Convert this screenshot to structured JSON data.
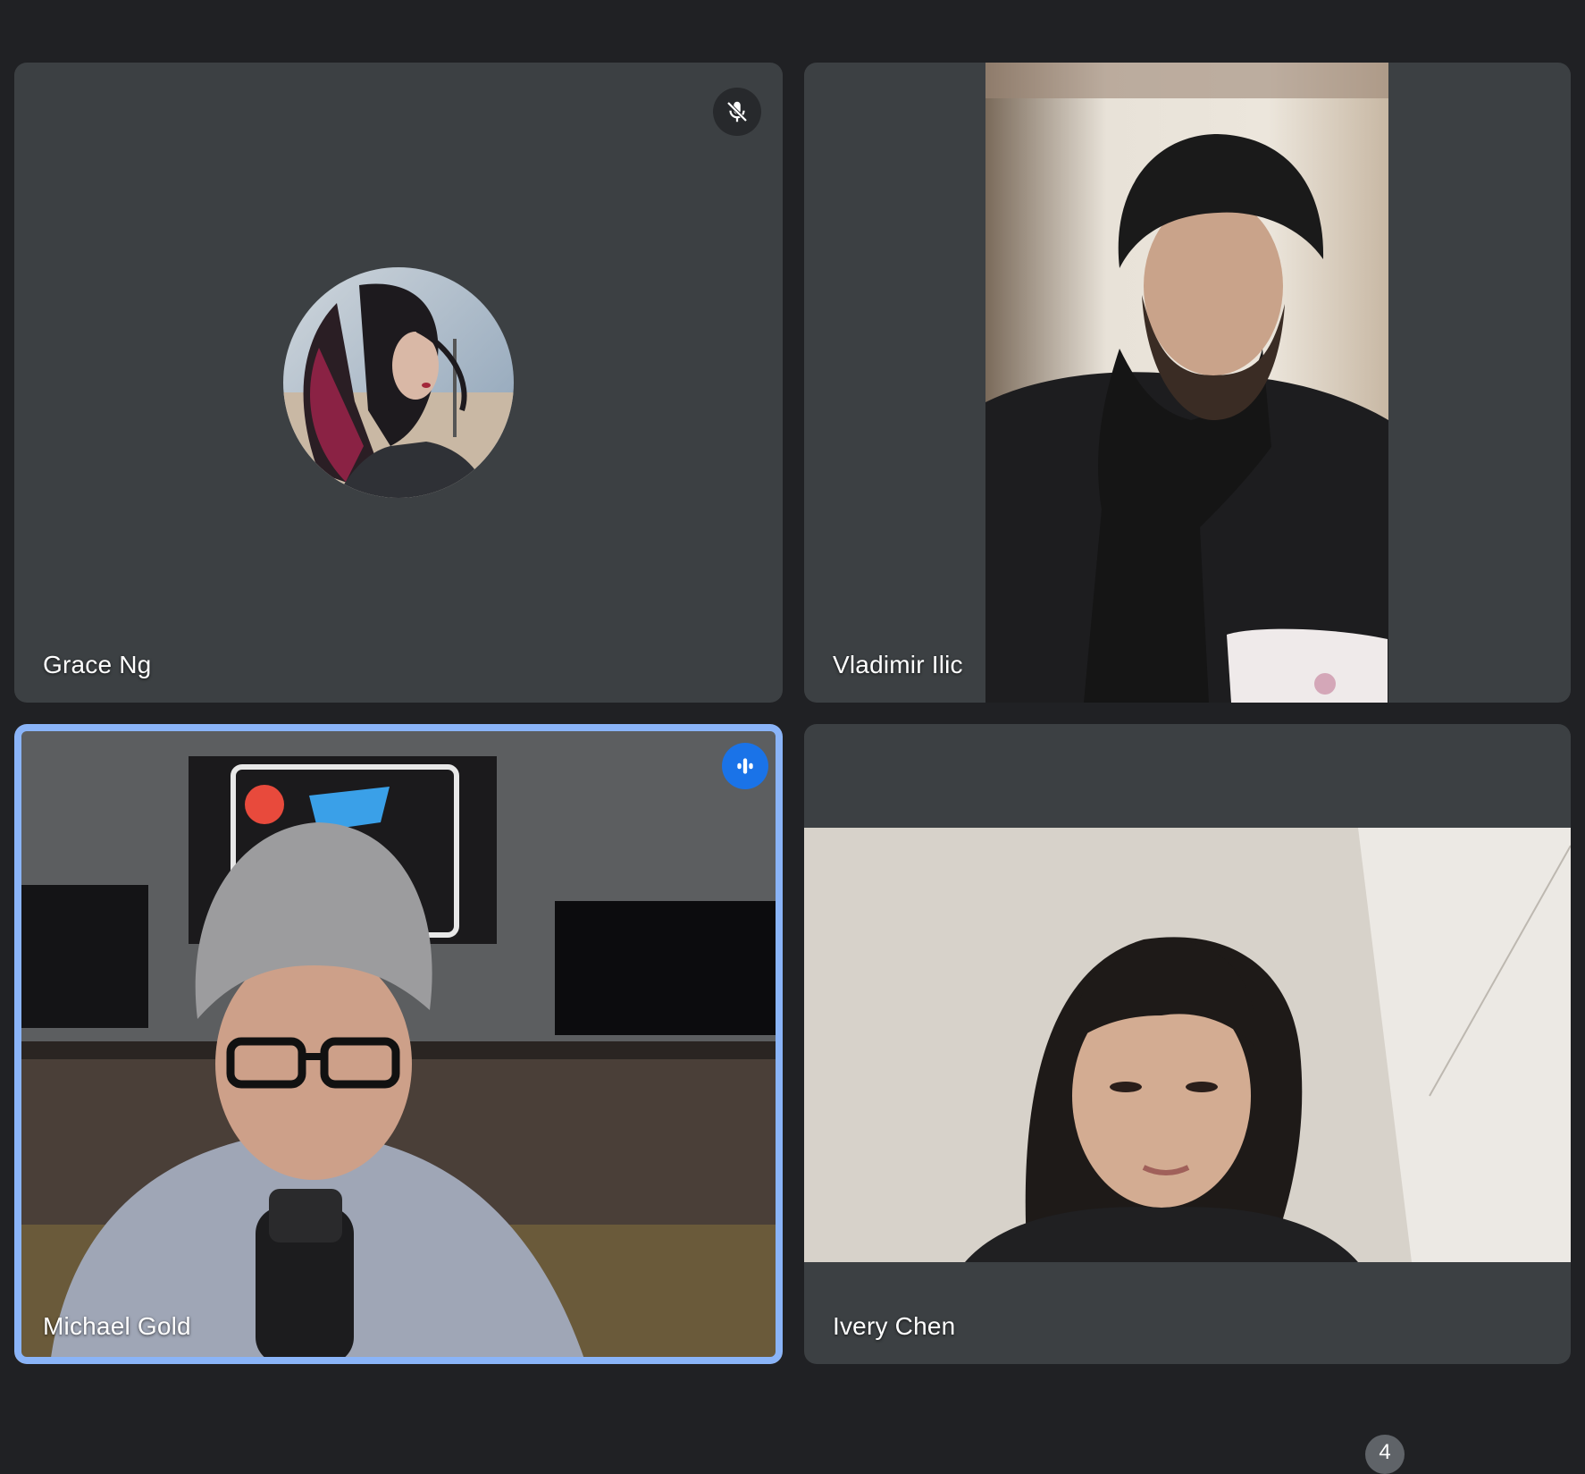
{
  "participants": [
    {
      "name": "Grace Ng",
      "status_icon": "mic-off-icon"
    },
    {
      "name": "Vladimir Ilic"
    },
    {
      "name": "Michael Gold",
      "status_icon": "speaking-icon",
      "active_speaker": true
    },
    {
      "name": "Ivery Chen"
    }
  ],
  "participant_count": "4",
  "colors": {
    "background": "#202124",
    "tile": "#3c4043",
    "active_border": "#8ab4f8",
    "speaking_badge": "#1a73e8"
  }
}
